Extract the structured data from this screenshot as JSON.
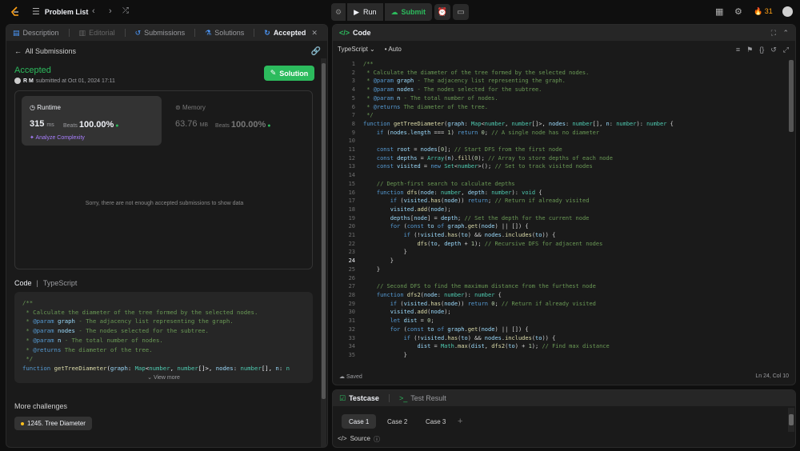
{
  "topbar": {
    "problem_list": "Problem List",
    "run": "Run",
    "submit": "Submit",
    "streak": "31"
  },
  "left": {
    "tabs": [
      "Description",
      "Editorial",
      "Submissions",
      "Solutions",
      "Accepted"
    ],
    "all_submissions": "All Submissions",
    "status": "Accepted",
    "user": "R M",
    "submitted_at": "submitted at Oct 01, 2024 17:11",
    "solution_button": "Solution",
    "runtime": {
      "label": "Runtime",
      "value": "315",
      "unit": "ms",
      "beats_label": "Beats",
      "beats": "100.00%",
      "analyze": "Analyze Complexity"
    },
    "memory": {
      "label": "Memory",
      "value": "63.76",
      "unit": "MB",
      "beats_label": "Beats",
      "beats": "100.00%"
    },
    "sorry": "Sorry, there are not enough accepted submissions to show data",
    "code_label": "Code",
    "lang": "TypeScript",
    "view_more": "View more",
    "more_challenges": "More challenges",
    "challenge": "1245. Tree Diameter"
  },
  "right": {
    "title": "Code",
    "lang": "TypeScript",
    "mode": "Auto",
    "saved": "Saved",
    "cursor": "Ln 24, Col 10",
    "current_line": 24,
    "testcase": "Testcase",
    "test_result": "Test Result",
    "cases": [
      "Case 1",
      "Case 2",
      "Case 3"
    ],
    "source": "Source"
  },
  "colors": {
    "green": "#2cbb5d",
    "orange": "#ffa116",
    "purple": "#a97fff"
  }
}
